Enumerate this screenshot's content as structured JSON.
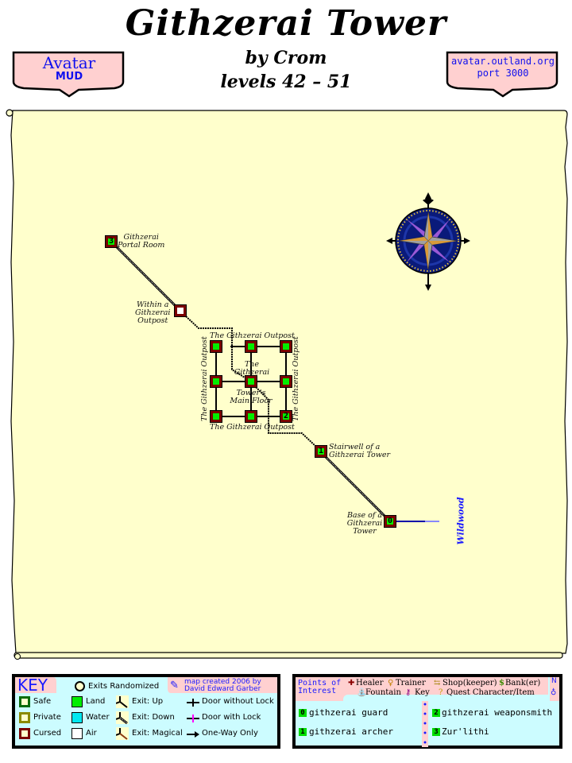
{
  "header": {
    "title": "Githzerai Tower",
    "author": "by Crom",
    "levels": "levels 42 – 51"
  },
  "badges": {
    "left": {
      "line1": "Avatar",
      "line2": "MUD"
    },
    "right": {
      "line1": "avatar.outland.org",
      "line2": "port 3000"
    }
  },
  "map": {
    "rooms": [
      {
        "id": "portal-room",
        "label": "Githzerai Portal Room",
        "number": "3",
        "type": "land"
      },
      {
        "id": "within-outpost",
        "label": "Within a Githzerai Outpost",
        "number": "",
        "type": "air"
      },
      {
        "id": "outpost-nw",
        "label": "",
        "number": "",
        "type": "land"
      },
      {
        "id": "outpost-n",
        "label": "",
        "number": "",
        "type": "land"
      },
      {
        "id": "outpost-ne",
        "label": "",
        "number": "",
        "type": "land"
      },
      {
        "id": "outpost-w",
        "label": "",
        "number": "",
        "type": "land"
      },
      {
        "id": "main-floor",
        "label": "The Githzerai Tower's Main Floor",
        "number": "",
        "type": "land"
      },
      {
        "id": "outpost-e",
        "label": "",
        "number": "",
        "type": "land"
      },
      {
        "id": "outpost-sw",
        "label": "",
        "number": "",
        "type": "land"
      },
      {
        "id": "outpost-s",
        "label": "",
        "number": "",
        "type": "land"
      },
      {
        "id": "outpost-se",
        "label": "",
        "number": "2",
        "type": "land"
      },
      {
        "id": "stairwell",
        "label": "Stairwell of a Githzerai Tower",
        "number": "1",
        "type": "land"
      },
      {
        "id": "base",
        "label": "Base of a Githzerai Tower",
        "number": "0",
        "type": "land"
      }
    ],
    "labels": {
      "portal_l1": "Githzerai",
      "portal_l2": "Portal Room",
      "within_l1": "Within a",
      "within_l2": "Githzerai",
      "within_l3": "Outpost",
      "outpost_top": "The Githzerai Outpost",
      "outpost_bottom": "The Githzerai Outpost",
      "outpost_left": "The Githzerai Outpost",
      "outpost_right": "The Githzerai Outpost",
      "main_l1": "The",
      "main_l2": "Githzerai",
      "main_l3": "Tower's",
      "main_l4": "Main Floor",
      "stair_l1": "Stairwell of a",
      "stair_l2": "Githzerai Tower",
      "base_l1": "Base of a",
      "base_l2": "Githzerai",
      "base_l3": "Tower",
      "exit_area": "Wildwood"
    }
  },
  "key": {
    "title": "KEY",
    "exits_randomized": "Exits Randomized",
    "credit_l1": "map created 2006 by",
    "credit_l2": "David Edward Garber",
    "zones": [
      "Safe",
      "Private",
      "Cursed"
    ],
    "terrain": [
      "Land",
      "Water",
      "Air"
    ],
    "exits": [
      "Exit: Up",
      "Exit: Down",
      "Exit: Magical"
    ],
    "doors": [
      "Door without Lock",
      "Door with Lock",
      "One-Way Only"
    ],
    "colors": {
      "safe": "#0a6b0a",
      "private": "#8a8a00",
      "cursed": "#7a0000",
      "land": "#00ee00",
      "water": "#00e8f0",
      "air": "#ffffff",
      "lock": "#ff00ff"
    }
  },
  "poi": {
    "title_l1": "Points of",
    "title_l2": "Interest",
    "types": {
      "healer": "Healer",
      "trainer": "Trainer",
      "shop": "Shop(keeper)",
      "bank": "Bank(er)",
      "fountain": "Fountain",
      "key": "Key",
      "quest": "Quest Character/Item"
    },
    "entries": [
      {
        "num": "0",
        "name": "githzerai guard"
      },
      {
        "num": "1",
        "name": "githzerai archer"
      },
      {
        "num": "2",
        "name": "githzerai weaponsmith"
      },
      {
        "num": "3",
        "name": "Zur'lithi"
      }
    ],
    "compass_letter": "N"
  }
}
